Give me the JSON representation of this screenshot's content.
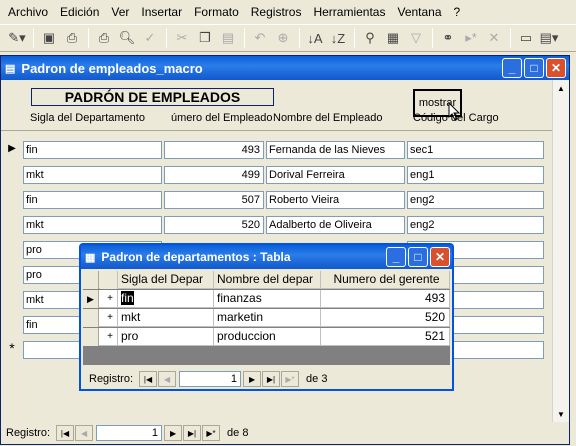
{
  "menu": [
    "Archivo",
    "Edición",
    "Ver",
    "Insertar",
    "Formato",
    "Registros",
    "Herramientas",
    "Ventana",
    "?"
  ],
  "toolbar_icons": [
    "design-view-icon",
    "save-icon",
    "print-preview-icon",
    "print-icon",
    "preview-icon",
    "spelling-icon",
    "cut-icon",
    "copy-icon",
    "paste-icon",
    "undo-icon",
    "hyperlink-icon",
    "sort-asc-icon",
    "sort-desc-icon",
    "filter-selection-icon",
    "filter-form-icon",
    "apply-filter-icon",
    "find-icon",
    "new-record-icon",
    "delete-record-icon",
    "database-window-icon",
    "new-object-icon"
  ],
  "main": {
    "title": "Padron de empleados_macro",
    "form_title": "PADRÓN DE EMPLEADOS",
    "button_label": "mostrar",
    "headers": {
      "dept": "Sigla del Departamento",
      "emp": "úmero del Empleado",
      "name": "Nombre del Empleado",
      "job": "Código del Cargo"
    },
    "rows": [
      {
        "dept": "fin",
        "emp": "493",
        "name": "Fernanda de las Nieves",
        "job": "sec1"
      },
      {
        "dept": "mkt",
        "emp": "499",
        "name": "Dorival Ferreira",
        "job": "eng1"
      },
      {
        "dept": "fin",
        "emp": "507",
        "name": "Roberto Vieira",
        "job": "eng2"
      },
      {
        "dept": "mkt",
        "emp": "520",
        "name": "Adalberto de Oliveira",
        "job": "eng2"
      },
      {
        "dept": "pro",
        "emp": "",
        "name": "",
        "job": ""
      },
      {
        "dept": "pro",
        "emp": "",
        "name": "",
        "job": ""
      },
      {
        "dept": "mkt",
        "emp": "",
        "name": "",
        "job": ""
      },
      {
        "dept": "fin",
        "emp": "",
        "name": "",
        "job": ""
      }
    ],
    "new_row_marker": "*",
    "nav": {
      "label": "Registro:",
      "current": "1",
      "of": "de 8"
    }
  },
  "child": {
    "title": "Padron de departamentos : Tabla",
    "columns": [
      "Sigla del Depar",
      "Nombre del depar",
      "Numero del gerente"
    ],
    "rows": [
      {
        "marker": "▶",
        "expand": "+",
        "sigla": "fin",
        "nombre": "finanzas",
        "gerente": "493"
      },
      {
        "marker": "",
        "expand": "+",
        "sigla": "mkt",
        "nombre": "marketin",
        "gerente": "520"
      },
      {
        "marker": "",
        "expand": "+",
        "sigla": "pro",
        "nombre": "produccion",
        "gerente": "521"
      }
    ],
    "nav": {
      "label": "Registro:",
      "current": "1",
      "of": "de 3"
    }
  },
  "colors": {
    "title_bar": "#0a5fd8",
    "close_btn": "#d8512c",
    "window_bg": "#ece9d8"
  }
}
